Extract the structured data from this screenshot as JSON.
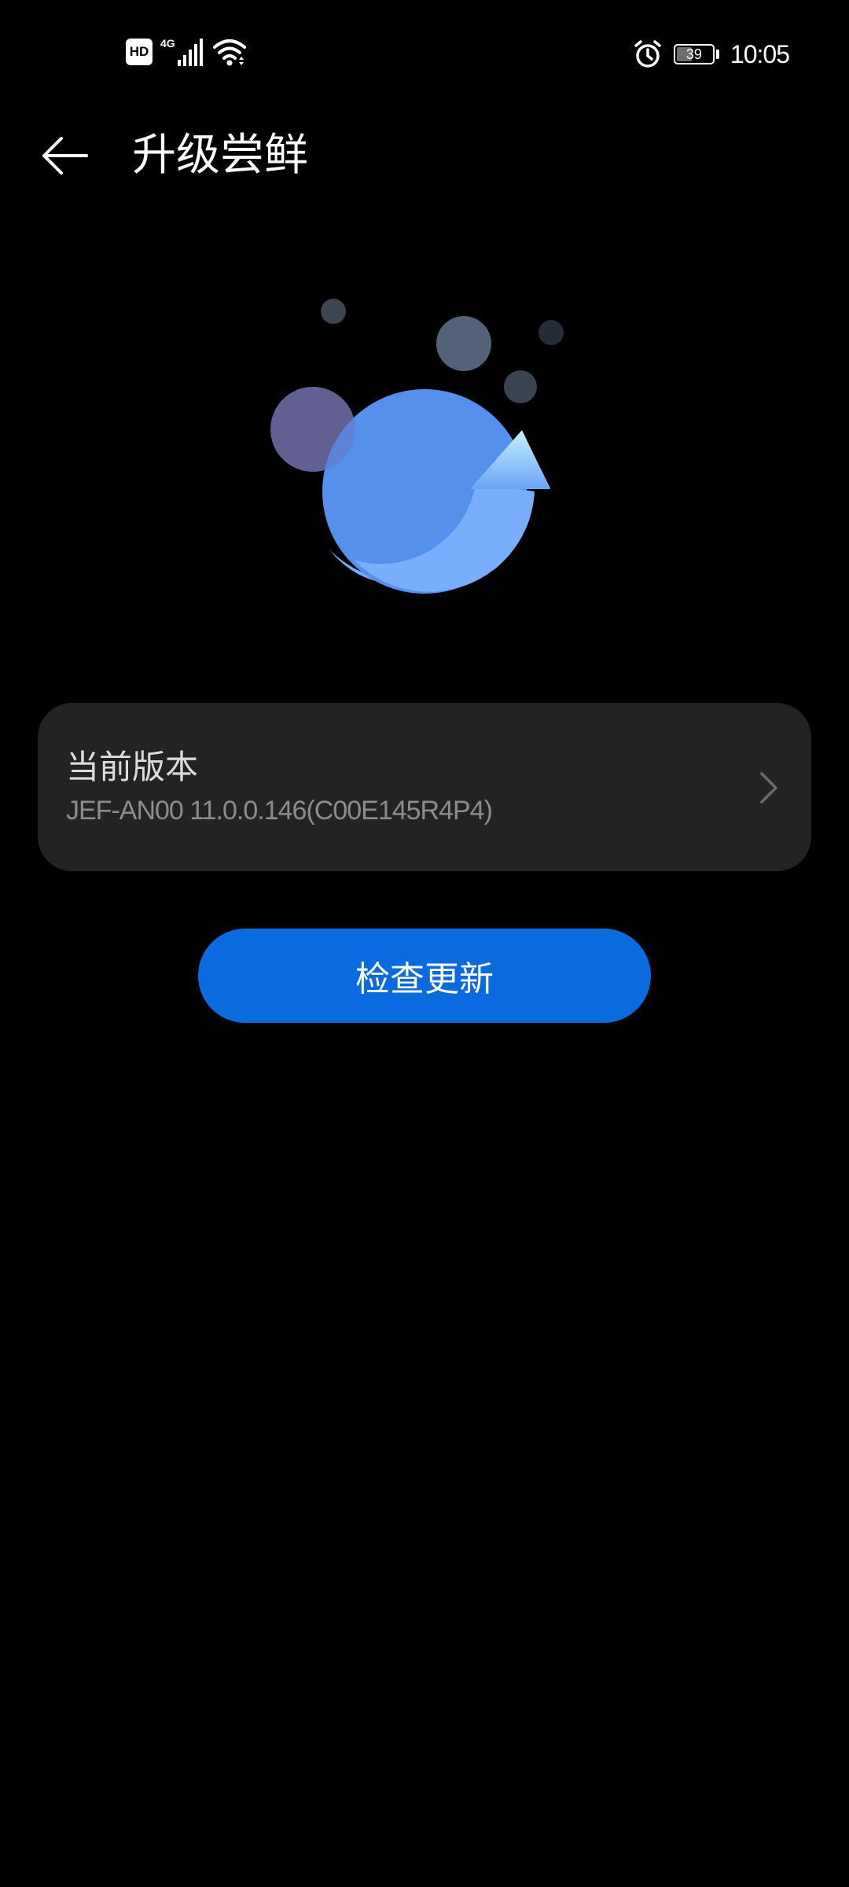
{
  "status_bar": {
    "hd_label": "HD",
    "network_label": "4G",
    "battery_level": "39",
    "time": "10:05",
    "icons": [
      "hd-icon",
      "signal-icon",
      "wifi-icon",
      "alarm-icon",
      "battery-icon"
    ]
  },
  "header": {
    "back_icon": "back-arrow-icon",
    "title": "升级尝鲜"
  },
  "illustration": {
    "icon": "update-bubbles-illustration",
    "colors": {
      "main_circle": "#5590ec",
      "arrow_light": "#bfe9ff",
      "purple_bubble": "#5d5a80",
      "grey_bubble": "#536179"
    }
  },
  "version_card": {
    "label": "当前版本",
    "value": "JEF-AN00 11.0.0.146(C00E145R4P4)",
    "chevron_icon": "chevron-right-icon"
  },
  "actions": {
    "check_update_label": "检查更新"
  },
  "colors": {
    "background": "#000000",
    "card": "#232325",
    "accent": "#0a6be0"
  }
}
